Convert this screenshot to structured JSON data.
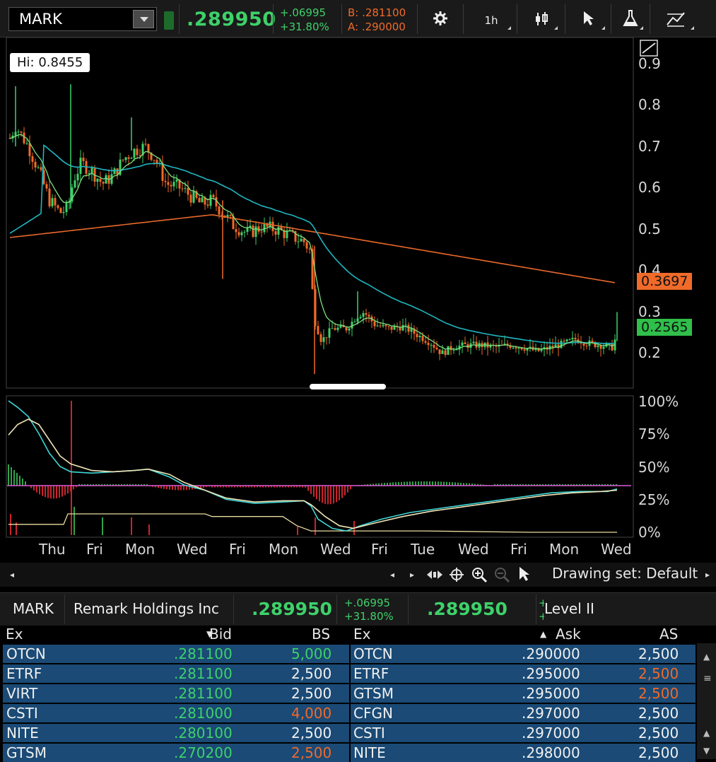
{
  "toolbar": {
    "symbol": "MARK",
    "last_price": ".289950",
    "change_abs": "+.06995",
    "change_pct": "+31.80%",
    "bid": "B: .281100",
    "ask": "A: .290000",
    "timeframe": "1h"
  },
  "price_chart": {
    "hi_label": "Hi: 0.8455",
    "y_ticks": [
      "0.9",
      "0.8",
      "0.7",
      "0.6",
      "0.5",
      "0.4",
      "0.3",
      "0.2"
    ],
    "tag_orange": "0.3697",
    "tag_green": "0.2565"
  },
  "osc_chart": {
    "y_ticks": [
      "100%",
      "75%",
      "50%",
      "25%",
      "0%"
    ]
  },
  "x_axis": [
    "Thu",
    "Fri",
    "Mon",
    "Wed",
    "Fri",
    "Mon",
    "Wed",
    "Fri",
    "Tue",
    "Wed",
    "Fri",
    "Mon",
    "Wed"
  ],
  "nav": {
    "drawing_set": "Drawing set: Default"
  },
  "level2": {
    "symbol": "MARK",
    "name": "Remark Holdings Inc",
    "last": ".289950",
    "change_abs": "+.06995",
    "change_pct": "+31.80%",
    "last2": ".289950",
    "change_abs_cut": "+.0",
    "change_pct_cut": "+3",
    "title": "Level II",
    "headers": {
      "ex": "Ex",
      "bid": "Bid",
      "bs": "BS",
      "ex2": "Ex",
      "ask": "Ask",
      "as": "AS"
    },
    "rows": [
      {
        "bex": "OTCN",
        "bid": ".281100",
        "bs": "5,000",
        "bs_color": "g",
        "aex": "OTCN",
        "ask": ".290000",
        "as": "2,500",
        "as_color": "w"
      },
      {
        "bex": "ETRF",
        "bid": ".281100",
        "bs": "2,500",
        "bs_color": "w",
        "aex": "ETRF",
        "ask": ".295000",
        "as": "2,500",
        "as_color": "o"
      },
      {
        "bex": "VIRT",
        "bid": ".281100",
        "bs": "2,500",
        "bs_color": "w",
        "aex": "GTSM",
        "ask": ".295000",
        "as": "2,500",
        "as_color": "o"
      },
      {
        "bex": "CSTI",
        "bid": ".281000",
        "bs": "4,000",
        "bs_color": "o",
        "aex": "CFGN",
        "ask": ".297000",
        "as": "2,500",
        "as_color": "w"
      },
      {
        "bex": "NITE",
        "bid": ".280100",
        "bs": "2,500",
        "bs_color": "w",
        "aex": "CSTI",
        "ask": ".297000",
        "as": "2,500",
        "as_color": "w"
      },
      {
        "bex": "GTSM",
        "bid": ".270200",
        "bs": "2,500",
        "bs_color": "o",
        "aex": "NITE",
        "ask": ".298000",
        "as": "2,500",
        "as_color": "w"
      }
    ]
  },
  "colors": {
    "up": "#3ed16a",
    "down": "#f06a2a",
    "ma_slow": "#e8692a",
    "ma_mid": "#1fb7c2",
    "ma_fast": "#7fe07f",
    "row_bg": "#1a4a75"
  }
}
